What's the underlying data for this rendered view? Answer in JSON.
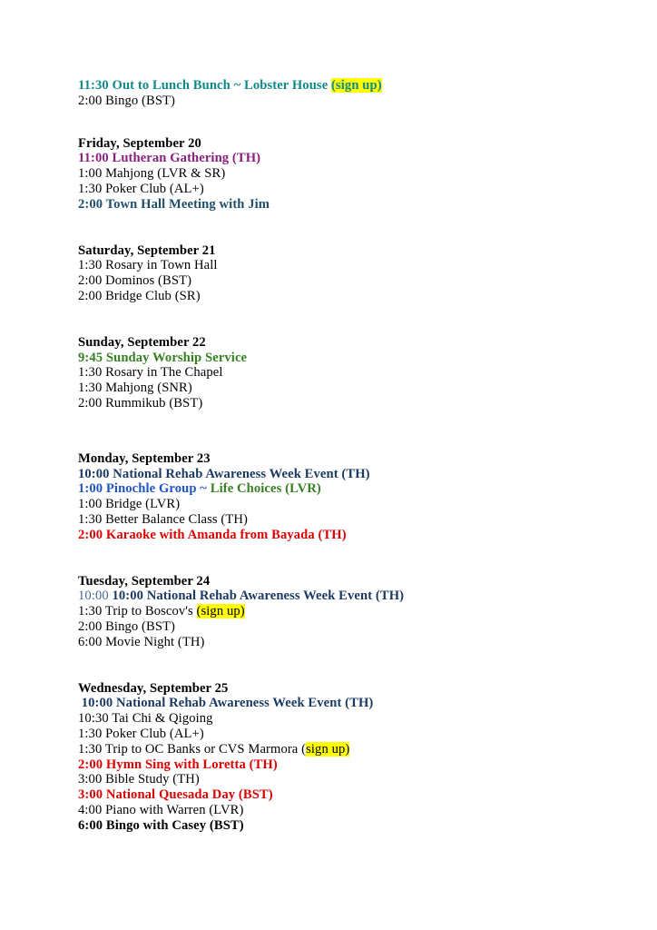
{
  "document": {
    "title": "Activity Calendar",
    "colors": {
      "teal": "#0E8A8A",
      "purple": "#8C2080",
      "steel_blue": "#1F4E6B",
      "green": "#368022",
      "navy": "#1B3A63",
      "blue": "#2154C4",
      "slate_blue": "#45699B",
      "red": "#DD0000",
      "black": "#000000",
      "highlight": "#FFFF00",
      "background": "#FFFFFF"
    }
  },
  "sections": [
    {
      "id": "partial-top",
      "heading": null,
      "lines": [
        {
          "id": "line-lunch-bunch",
          "runs": [
            {
              "text": "11:30 Out to Lunch Bunch ~ Lobster House ",
              "color": "teal",
              "bold": true,
              "highlight": false
            },
            {
              "text": "(sign up)",
              "color": "teal",
              "bold": true,
              "highlight": true
            }
          ]
        },
        {
          "id": "line-bingo-bst",
          "runs": [
            {
              "text": "2:00 Bingo (BST)",
              "color": "black",
              "bold": false,
              "highlight": false
            }
          ]
        }
      ]
    },
    {
      "id": "friday-sept-20",
      "heading": "Friday, September 20",
      "lines": [
        {
          "id": "line-lutheran-gathering",
          "runs": [
            {
              "text": "11:00 Lutheran Gathering (TH)",
              "color": "purple",
              "bold": true,
              "highlight": false
            }
          ]
        },
        {
          "id": "line-mahjong-lvr-sr",
          "runs": [
            {
              "text": "1:00 Mahjong (LVR & SR)",
              "color": "black",
              "bold": false,
              "highlight": false
            }
          ]
        },
        {
          "id": "line-poker-club-al",
          "runs": [
            {
              "text": "1:30 Poker Club (AL+)",
              "color": "black",
              "bold": false,
              "highlight": false
            }
          ]
        },
        {
          "id": "line-town-hall-meeting",
          "runs": [
            {
              "text": "2:00 Town Hall Meeting with Jim",
              "color": "steel_blue",
              "bold": true,
              "highlight": false
            }
          ]
        }
      ]
    },
    {
      "id": "saturday-sept-21",
      "heading": "Saturday, September 21",
      "lines": [
        {
          "id": "line-rosary-town-hall",
          "runs": [
            {
              "text": "1:30 Rosary in Town Hall",
              "color": "black",
              "bold": false,
              "highlight": false
            }
          ]
        },
        {
          "id": "line-dominos-bst",
          "runs": [
            {
              "text": "2:00 Dominos (BST)",
              "color": "black",
              "bold": false,
              "highlight": false
            }
          ]
        },
        {
          "id": "line-bridge-club-sr",
          "runs": [
            {
              "text": "2:00 Bridge Club (SR)",
              "color": "black",
              "bold": false,
              "highlight": false
            }
          ]
        }
      ]
    },
    {
      "id": "sunday-sept-22",
      "heading": "Sunday, September 22",
      "lines": [
        {
          "id": "line-sunday-worship",
          "runs": [
            {
              "text": "9:45 Sunday Worship Service",
              "color": "green",
              "bold": true,
              "highlight": false
            }
          ]
        },
        {
          "id": "line-rosary-chapel",
          "runs": [
            {
              "text": "1:30 Rosary in The Chapel",
              "color": "black",
              "bold": false,
              "highlight": false
            }
          ]
        },
        {
          "id": "line-mahjong-snr",
          "runs": [
            {
              "text": "1:30 Mahjong (SNR)",
              "color": "black",
              "bold": false,
              "highlight": false
            }
          ]
        },
        {
          "id": "line-rummikub-bst",
          "runs": [
            {
              "text": "2:00 Rummikub (BST)",
              "color": "black",
              "bold": false,
              "highlight": false
            }
          ]
        }
      ]
    },
    {
      "id": "monday-sept-23",
      "heading": "Monday, September 23",
      "lines": [
        {
          "id": "line-rehab-awareness-mon",
          "runs": [
            {
              "text": "10:00 National Rehab Awareness Week Event (TH)",
              "color": "navy",
              "bold": true,
              "highlight": false
            }
          ]
        },
        {
          "id": "line-pinochle-group",
          "runs": [
            {
              "text": "1:00 Pinochle Group ~ ",
              "color": "blue",
              "bold": true,
              "highlight": false
            },
            {
              "text": "Life Choices (LVR)",
              "color": "green",
              "bold": true,
              "highlight": false
            }
          ]
        },
        {
          "id": "line-bridge-lvr",
          "runs": [
            {
              "text": "1:00 Bridge (LVR)",
              "color": "black",
              "bold": false,
              "highlight": false
            }
          ]
        },
        {
          "id": "line-better-balance-class",
          "runs": [
            {
              "text": "1:30 Better Balance Class (TH)",
              "color": "black",
              "bold": false,
              "highlight": false
            }
          ]
        },
        {
          "id": "line-karaoke-amanda",
          "runs": [
            {
              "text": "2:00 Karaoke with Amanda from Bayada (TH)",
              "color": "red",
              "bold": true,
              "highlight": false
            }
          ]
        }
      ]
    },
    {
      "id": "tuesday-sept-24",
      "heading": "Tuesday, September 24",
      "lines": [
        {
          "id": "line-rehab-awareness-tue",
          "runs": [
            {
              "text": "10:00 ",
              "color": "slate_blue",
              "bold": false,
              "highlight": false
            },
            {
              "text": "10:00 National Rehab Awareness Week Event (TH)",
              "color": "navy",
              "bold": true,
              "highlight": false
            }
          ]
        },
        {
          "id": "line-trip-boscovs",
          "runs": [
            {
              "text": "1:30 Trip to Boscov's ",
              "color": "black",
              "bold": false,
              "highlight": false
            },
            {
              "text": "(sign up)",
              "color": "black",
              "bold": false,
              "highlight": true
            }
          ]
        },
        {
          "id": "line-bingo-bst-tue",
          "runs": [
            {
              "text": "2:00 Bingo (BST)",
              "color": "black",
              "bold": false,
              "highlight": false
            }
          ]
        },
        {
          "id": "line-movie-night",
          "runs": [
            {
              "text": "6:00 Movie Night (TH)",
              "color": "black",
              "bold": false,
              "highlight": false
            }
          ]
        }
      ]
    },
    {
      "id": "wednesday-sept-25",
      "heading": "Wednesday, September 25",
      "lines": [
        {
          "id": "line-rehab-awareness-wed",
          "runs": [
            {
              "text": " 10:00 National Rehab Awareness Week Event (TH)",
              "color": "navy",
              "bold": true,
              "highlight": false
            }
          ]
        },
        {
          "id": "line-tai-chi-qigoing",
          "runs": [
            {
              "text": "10:30 Tai Chi & Qigoing",
              "color": "black",
              "bold": false,
              "highlight": false
            }
          ]
        },
        {
          "id": "line-poker-club-al-wed",
          "runs": [
            {
              "text": "1:30 Poker Club (AL+)",
              "color": "black",
              "bold": false,
              "highlight": false
            }
          ]
        },
        {
          "id": "line-trip-oc-banks",
          "runs": [
            {
              "text": "1:30 Trip to OC Banks or CVS Marmora (",
              "color": "black",
              "bold": false,
              "highlight": false
            },
            {
              "text": "sign up)",
              "color": "black",
              "bold": false,
              "highlight": true
            }
          ]
        },
        {
          "id": "line-hymn-sing-loretta",
          "runs": [
            {
              "text": "2:00 Hymn Sing with Loretta (TH)",
              "color": "red",
              "bold": true,
              "highlight": false
            }
          ]
        },
        {
          "id": "line-bible-study",
          "runs": [
            {
              "text": "3:00 Bible Study (TH)",
              "color": "black",
              "bold": false,
              "highlight": false
            }
          ]
        },
        {
          "id": "line-national-quesada-day",
          "runs": [
            {
              "text": "3:00 National Quesada Day (BST)",
              "color": "red",
              "bold": true,
              "highlight": false
            }
          ]
        },
        {
          "id": "line-piano-warren",
          "runs": [
            {
              "text": "4:00 Piano with Warren (LVR)",
              "color": "black",
              "bold": false,
              "highlight": false
            }
          ]
        },
        {
          "id": "line-bingo-casey",
          "runs": [
            {
              "text": "6:00 Bingo with Casey (BST)",
              "color": "black",
              "bold": true,
              "highlight": false
            }
          ]
        }
      ]
    }
  ]
}
